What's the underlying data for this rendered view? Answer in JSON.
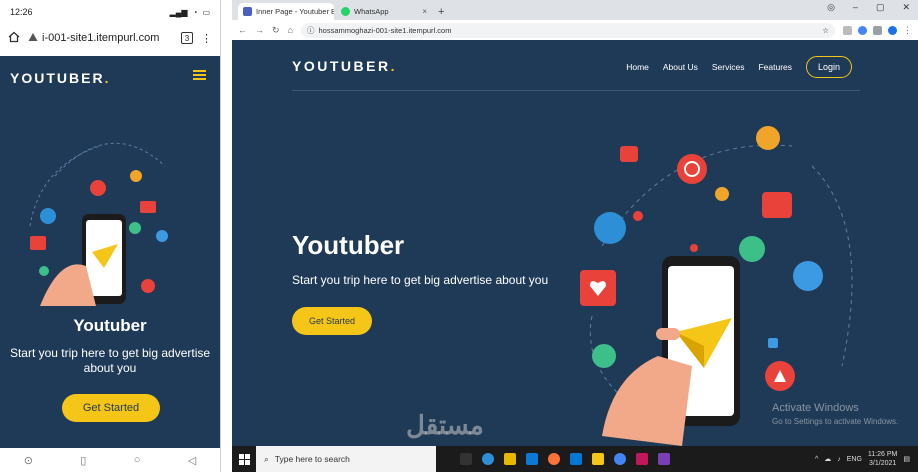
{
  "mobile": {
    "status_time": "12:26",
    "url": "i-001-site1.itempurl.com",
    "tab_count": "3",
    "logo": "YOUTUBER",
    "logo_dot": ".",
    "hero_title": "Youtuber",
    "hero_subtitle": "Start you trip here to get big advertise about you",
    "cta": "Get Started"
  },
  "browser": {
    "tabs": [
      {
        "label": "Inner Page - Youtuber B..."
      },
      {
        "label": "WhatsApp"
      }
    ],
    "url": "hossammoghazi-001-site1.itempurl.com"
  },
  "site": {
    "logo": "YOUTUBER",
    "logo_dot": ".",
    "nav": [
      "Home",
      "About Us",
      "Services",
      "Features"
    ],
    "login": "Login",
    "hero_title": "Youtuber",
    "hero_subtitle": "Start you trip here to get big advertise about you",
    "cta": "Get Started",
    "activate_title": "Activate Windows",
    "activate_sub": "Go to Settings to activate Windows."
  },
  "taskbar": {
    "search_placeholder": "Type here to search",
    "lang": "ENG",
    "time": "11:26 PM",
    "date": "3/1/2021"
  },
  "colors": {
    "navy": "#1f3a57",
    "accent": "#f5c518"
  },
  "watermark": "مستقل"
}
